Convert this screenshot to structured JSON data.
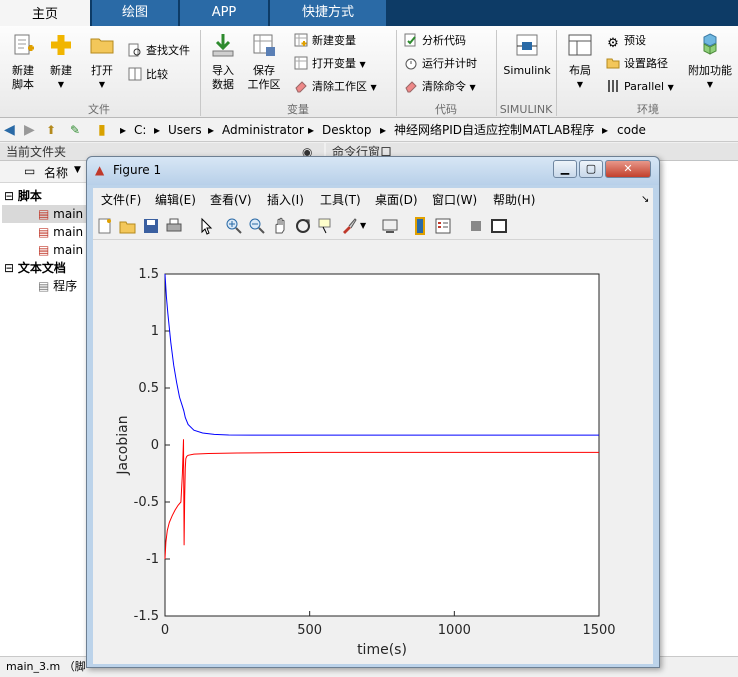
{
  "tabs": [
    {
      "label": "主页",
      "active": true
    },
    {
      "label": "绘图",
      "active": false
    },
    {
      "label": "APP",
      "active": false
    },
    {
      "label": "快捷方式",
      "active": false
    }
  ],
  "ribbon": {
    "new_script": "新建\n脚本",
    "new": "新建",
    "open": "打开",
    "find_files": "查找文件",
    "compare": "比较",
    "import_data": "导入\n数据",
    "save_workspace": "保存\n工作区",
    "new_variable": "新建变量",
    "open_variable": "打开变量",
    "clear_workspace": "清除工作区",
    "analyze_code": "分析代码",
    "run_and_time": "运行并计时",
    "clear_commands": "清除命令",
    "simulink": "Simulink",
    "layout": "布局",
    "preferences": "预设",
    "set_path": "设置路径",
    "parallel": "Parallel",
    "addons": "附加功能",
    "groups": {
      "file": "文件",
      "variable": "变量",
      "code": "代码",
      "simulink": "SIMULINK",
      "environment": "环境"
    }
  },
  "address": {
    "path": [
      "C:",
      "Users",
      "Administrator",
      "Desktop",
      "神经网络PID自适应控制MATLAB程序",
      "code"
    ]
  },
  "current_folder": {
    "title": "当前文件夹",
    "column_name": "名称",
    "sections": [
      {
        "label": "脚本",
        "files": [
          "main",
          "main",
          "main"
        ]
      },
      {
        "label": "文本文档",
        "files": [
          "程序"
        ]
      }
    ]
  },
  "command_window": {
    "title": "命令行窗口"
  },
  "statusbar": {
    "text": "main_3.m （脚"
  },
  "figure": {
    "title": "Figure 1",
    "menu": [
      "文件(F)",
      "编辑(E)",
      "查看(V)",
      "插入(I)",
      "工具(T)",
      "桌面(D)",
      "窗口(W)",
      "帮助(H)"
    ],
    "toolbar_icons": [
      "new-figure-icon",
      "open-file-icon",
      "save-icon",
      "print-icon",
      "pointer-icon",
      "zoom-in-icon",
      "zoom-out-icon",
      "pan-icon",
      "rotate-icon",
      "data-cursor-icon",
      "brush-icon",
      "link-icon",
      "colorbar-icon",
      "legend-icon",
      "hide-plot-tools-icon",
      "show-plot-tools-icon"
    ]
  },
  "chart_data": {
    "type": "line",
    "xlabel": "time(s)",
    "ylabel": "Jacobian",
    "xlim": [
      0,
      1500
    ],
    "ylim": [
      -1.5,
      1.5
    ],
    "xticks": [
      0,
      500,
      1000,
      1500
    ],
    "yticks": [
      -1.5,
      -1,
      -0.5,
      0,
      0.5,
      1,
      1.5
    ],
    "grid": false,
    "series": [
      {
        "color": "#0000ff",
        "x": [
          0,
          5,
          10,
          20,
          30,
          40,
          50,
          60,
          65,
          70,
          80,
          100,
          130,
          170,
          220,
          300,
          400,
          600,
          900,
          1200,
          1500
        ],
        "y": [
          1.5,
          1.3,
          1.15,
          0.9,
          0.7,
          0.55,
          0.42,
          0.34,
          0.3,
          0.24,
          0.18,
          0.13,
          0.105,
          0.093,
          0.088,
          0.087,
          0.087,
          0.087,
          0.087,
          0.087,
          0.087
        ]
      },
      {
        "color": "#ff0000",
        "x": [
          0,
          3,
          8,
          15,
          25,
          35,
          45,
          55,
          60,
          64,
          66,
          68,
          70,
          72,
          75,
          80,
          100,
          150,
          250,
          500,
          1000,
          1500
        ],
        "y": [
          -1.0,
          -0.85,
          -0.75,
          -0.68,
          -0.62,
          -0.57,
          -0.53,
          -0.5,
          -0.25,
          0.05,
          -0.88,
          -0.45,
          -0.2,
          -0.12,
          -0.1,
          -0.09,
          -0.08,
          -0.075,
          -0.07,
          -0.065,
          -0.065,
          -0.065
        ]
      }
    ]
  }
}
